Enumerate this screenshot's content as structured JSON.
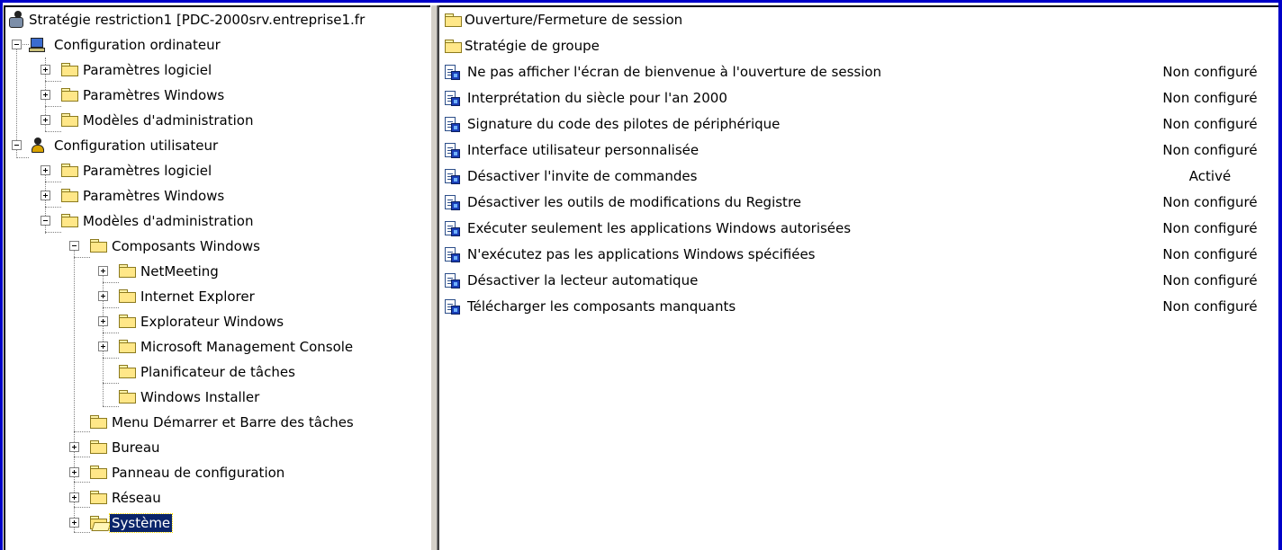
{
  "tree": {
    "root": "Stratégie restriction1 [PDC-2000srv.entreprise1.fr",
    "computer_config": "Configuration ordinateur",
    "comp_software": "Paramètres logiciel",
    "comp_windows": "Paramètres Windows",
    "comp_admin": "Modèles d'administration",
    "user_config": "Configuration utilisateur",
    "user_software": "Paramètres logiciel",
    "user_windows": "Paramètres Windows",
    "user_admin": "Modèles d'administration",
    "win_components": "Composants Windows",
    "netmeeting": "NetMeeting",
    "ie": "Internet Explorer",
    "explorer": "Explorateur Windows",
    "mmc": "Microsoft Management Console",
    "task_scheduler": "Planificateur de tâches",
    "installer": "Windows Installer",
    "start_menu": "Menu Démarrer et Barre des tâches",
    "desktop": "Bureau",
    "control_panel": "Panneau de configuration",
    "network": "Réseau",
    "system": "Système"
  },
  "list": {
    "folders": [
      "Ouverture/Fermeture de session",
      "Stratégie de groupe"
    ],
    "policies": [
      {
        "name": "Ne pas afficher l'écran de bienvenue à l'ouverture de session",
        "state": "Non configuré"
      },
      {
        "name": "Interprétation du siècle pour l'an 2000",
        "state": "Non configuré"
      },
      {
        "name": "Signature du code des pilotes de périphérique",
        "state": "Non configuré"
      },
      {
        "name": "Interface utilisateur personnalisée",
        "state": "Non configuré"
      },
      {
        "name": "Désactiver l'invite de commandes",
        "state": "Activé"
      },
      {
        "name": "Désactiver les outils de modifications du Registre",
        "state": "Non configuré"
      },
      {
        "name": "Exécuter seulement les applications Windows autorisées",
        "state": "Non configuré"
      },
      {
        "name": "N'exécutez pas les applications Windows spécifiées",
        "state": "Non configuré"
      },
      {
        "name": "Désactiver la lecteur automatique",
        "state": "Non configuré"
      },
      {
        "name": "Télécharger les composants manquants",
        "state": "Non configuré"
      }
    ]
  },
  "colors": {
    "selection": "#0a246a",
    "window_border": "#0000c8"
  }
}
